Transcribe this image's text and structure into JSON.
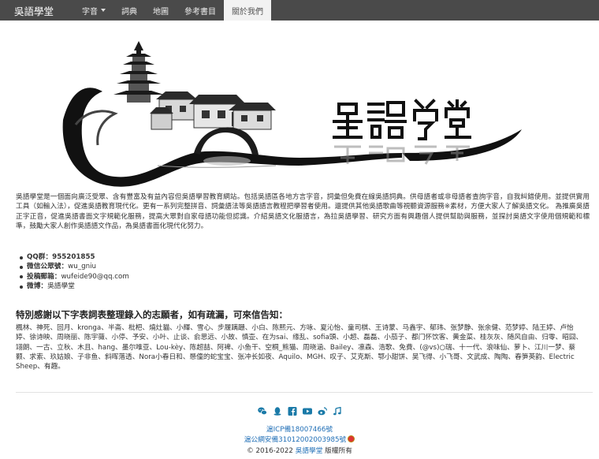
{
  "navbar": {
    "brand": "吳語學堂",
    "items": [
      {
        "label": "字音",
        "dropdown": true
      },
      {
        "label": "詞典",
        "dropdown": false
      },
      {
        "label": "地圖",
        "dropdown": false
      },
      {
        "label": "參考書目",
        "dropdown": false
      },
      {
        "label": "關於我們",
        "dropdown": false,
        "active": true
      }
    ]
  },
  "banner": {
    "logo_text": "吳語學堂"
  },
  "intro": {
    "paragraph": "吳語學堂是一個面向廣泛受眾、含有豐富及有益內容但吳語學習教育網站。包括吳語區各地方言字音，詞彙但免費在線吳語詞典。供母語者或非母語者查詢字音，自我糾錯使用。並提供實用工具（如輸入法），促進吳語教育現代化。更有一系列完整拼音、詞彙語法等吳語語言教程把學習者使用。還提供其他吳語歌曲等視聽資源服務※素材，方便大家人了解吳語文化。 為推廣吳語正字正音，促進吳語書面文字規範化服務，提高大眾對自家母語功能但認識。介紹吳語文化服語言，為拉吳語學習、研究方面有興趣個人提供幫助與服務，並探討吳語文字使用個規範和標準，鼓勵大家人創作吳語語文作品，為吳語書面化現代化努力。"
  },
  "contacts": [
    {
      "label": "QQ群：",
      "value": "955201855",
      "bold_value": true
    },
    {
      "label": "微信公眾號：",
      "value": "wu_gniu",
      "bold_value": false
    },
    {
      "label": "投稿郵箱：",
      "value": "wufeide90@qq.com",
      "bold_value": false
    },
    {
      "label": "微博：",
      "value": "吳語學堂",
      "bold_value": false
    }
  ],
  "thanks": {
    "title": "特別感謝以下字表詞表整理錄入的志願者，如有疏漏，可來信告知：",
    "names": "楓林、神死、回月、kronga、半斋、枇杷、燒灶貓、小輝、雪心、步履蹒跚、小白、陈熙元、方咏、夏沁怡、童司棋、王诗蒙、马鑫宇、郁玮、张梦静、张余健、范梦婷、陆王婷、卢怡婷、徐诗映、周晓丽、陈宇薇、小停、予安、小叶、止谈、俞思远、小故、慎壶、在为sai、缘乱、sofia頭、小超、磊磊、小茄子、都门怀饮客、黄金菜、桂灰灰、随风自由、归零、昭囧、翊朗、一古、立秋、木且、hang、墨尔唯亚、Lou-kèy、陈超喆、阿裨、小鱼干、空桐_熊猫、周晓涵、Bailey、凛森、浩歌、免費、(@vs)○瑞、十一代、浪味仙、萝卜、江川一梦、蔡颢、求索、玖姑娘、子非鱼、斜晖落透、Nora小春日和、懸僮的蛇宝宝、张冲长如夜、Aquilo、MGH、叹子、艾克斯、鄂小甜饼、吴飞得、小飞哥、文武成、陶陶、春笋英韵、Electric Sheep、有趣。"
  },
  "footer": {
    "social_icons": [
      "wechat-icon",
      "qq-icon",
      "facebook-icon",
      "youtube-icon",
      "weibo-icon",
      "music-icon"
    ],
    "icp": "滬ICP備18007466號",
    "police": "滬公網安備31012002003985號",
    "copyright_prefix": "© 2016-2022 ",
    "copyright_link": "吳語學堂",
    "copyright_suffix": " 版權所有"
  },
  "colors": {
    "navbar_bg": "#4a4a4a",
    "link": "#2270b7",
    "social": "#1a7aa8"
  }
}
